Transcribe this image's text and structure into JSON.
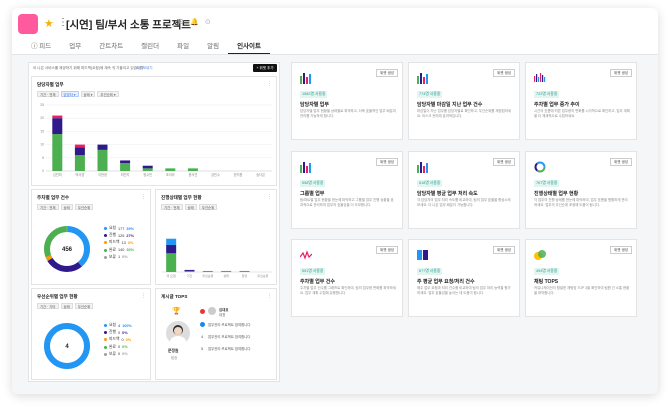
{
  "header": {
    "title": "[시연] 팀/부서 소통 프로젝트",
    "star_icon": "star-icon",
    "accent_color": "#ff5a9e"
  },
  "tabs": [
    {
      "label": "ⓘ 피드",
      "active": false
    },
    {
      "label": "업무",
      "active": false
    },
    {
      "label": "간트차트",
      "active": false
    },
    {
      "label": "캘린더",
      "active": false
    },
    {
      "label": "파일",
      "active": false
    },
    {
      "label": "알림",
      "active": false
    },
    {
      "label": "인사이트",
      "active": true
    }
  ],
  "left_panel": {
    "hint": "이 나은 서비스를 제공하기 위해 피드백(요청)에 계속 귀 기울이고 있습니다",
    "link": "의견보내기",
    "add_button": "+ 위젯 추가",
    "chips_all": [
      "기간 · 전체",
      "담당자",
      "상태",
      "우선순위"
    ]
  },
  "assignee_chart": {
    "title": "담당자별 업무",
    "chips": [
      "기간 · 전체",
      "담당자 ▾",
      "상태 ▾",
      "우선순위 ▾"
    ],
    "chart_data": {
      "type": "bar",
      "categories": [
        "김민희",
        "박서영",
        "이현정",
        "최민지",
        "정수빈",
        "조아라",
        "윤서연",
        "강민수",
        "한지원",
        "송다은"
      ],
      "series": [
        {
          "name": "완료",
          "color": "#4caf50",
          "values": [
            14,
            6,
            8,
            3,
            1,
            1,
            1,
            0,
            0,
            0
          ]
        },
        {
          "name": "진행",
          "color": "#2e1a8a",
          "values": [
            6,
            3,
            2,
            1,
            1,
            0,
            0,
            0,
            0,
            0
          ]
        },
        {
          "name": "요청",
          "color": "#e91e63",
          "values": [
            1,
            1,
            0,
            0,
            0,
            0,
            0,
            0,
            0,
            0
          ]
        }
      ],
      "yticks": [
        0,
        5,
        10,
        15,
        20,
        25
      ],
      "ylim": [
        0,
        25
      ]
    }
  },
  "status_card": {
    "title": "주차별 업무 건수",
    "chips": [
      "기간 · 전체",
      "상태",
      "우선순위"
    ],
    "total": "456",
    "legend": [
      {
        "label": "요청",
        "count": "177",
        "pct": "39%",
        "color": "#2196f3"
      },
      {
        "label": "진행",
        "count": "125",
        "count_pct": "",
        "pct": "27%",
        "color": "#2e1a8a"
      },
      {
        "label": "피드백",
        "count": "13",
        "pct": "3%",
        "color": "#ff9800"
      },
      {
        "label": "완료",
        "count": "140",
        "pct": "30%",
        "color": "#4caf50"
      },
      {
        "label": "보류",
        "count": "1",
        "pct": "0%",
        "color": "#9e9e9e"
      }
    ]
  },
  "progress_card": {
    "title": "진행상태별 업무 현황",
    "chips": [
      "기간 · 전체",
      "상태",
      "우선순위"
    ],
    "chart_data": {
      "type": "bar",
      "categories": [
        "미 요청",
        "기간",
        "우선순위",
        "상태",
        "담당",
        "우선순위"
      ],
      "series": [
        {
          "name": "완료",
          "color": "#4caf50",
          "values": [
            18,
            1,
            1,
            1,
            1,
            0
          ]
        },
        {
          "name": "진행",
          "color": "#2e1a8a",
          "values": [
            8,
            1,
            0,
            0,
            0,
            0
          ]
        },
        {
          "name": "요청",
          "color": "#2196f3",
          "values": [
            6,
            0,
            0,
            0,
            0,
            0
          ]
        }
      ],
      "ylim": [
        0,
        50
      ]
    }
  },
  "priority_card": {
    "title": "우선순위별 업무 현황",
    "chips": [
      "기간 · 기타",
      "상태",
      "우선순위"
    ],
    "total": "4",
    "legend": [
      {
        "label": "요청",
        "count": "4",
        "pct": "100%",
        "color": "#2196f3"
      },
      {
        "label": "진행",
        "count": "0",
        "pct": "0%",
        "color": "#2e1a8a"
      },
      {
        "label": "피드백",
        "count": "0",
        "pct": "0%",
        "color": "#ff9800"
      },
      {
        "label": "완료",
        "count": "0",
        "pct": "0%",
        "color": "#4caf50"
      },
      {
        "label": "보류",
        "count": "0",
        "pct": "0%",
        "color": "#9e9e9e"
      }
    ]
  },
  "tops_card": {
    "title": "게시글 TOPS",
    "user_name": "문정원",
    "user_role": "팀장",
    "items": [
      {
        "name": "김대표",
        "sub": "대표"
      },
      {
        "name": "업무관리 프로젝트 참여합니다",
        "sub": ""
      },
      {
        "name": "업무관리 프로젝트 참여합니다",
        "sub": ""
      },
      {
        "name": "업무관리 프로젝트 참여합니다",
        "sub": ""
      }
    ]
  },
  "gallery": [
    {
      "badge": "1582명 사용중",
      "name": "담당자별 업무",
      "desc": "담당자별 업무 현황을 상태별로 파악하고, 더욱 효율적인 업무 배분과 관리를 가능하게 합니다.",
      "icon": "bar-chart-icon",
      "button": "위젯 생성"
    },
    {
      "badge": "774명 사용중",
      "name": "담당자별 마감일 지난 업무 건수",
      "desc": "마감일이 지난 업무를 담당자별로 확인하고, 우선순위를 재정립하세요. 리스크 관리에 효과적입니다.",
      "icon": "bar-chart-icon",
      "button": "위젯 생성"
    },
    {
      "badge": "722명 사용중",
      "name": "주차별 업무 증가 추이",
      "desc": "시간의 흐름에 따른 업무량의 변화를 시각적으로 확인하고, 업무 계획을 더 체계적으로 수립하세요.",
      "icon": "wave-chart-icon",
      "button": "위젯 생성"
    },
    {
      "badge": "558명 사용중",
      "name": "그룹별 업무",
      "desc": "팀/파트별 업무 현황을 한눈에 파악하고 그룹별 업무 진행 상황을 효과적으로 관리하여 업무의 효율성을 더 도모합니다.",
      "icon": "bar-chart-icon",
      "button": "위젯 생성"
    },
    {
      "badge": "618명 사용중",
      "name": "담당자별 평균 업무 처리 속도",
      "desc": "각 담당자의 업무 처리 속도를 비교하여, 팀의 업무 효율을 향상시켜보세요. 더 나은 업무 배분이 가능합니다.",
      "icon": "bar-chart-icon",
      "button": "위젯 생성"
    },
    {
      "badge": "767명 사용중",
      "name": "진행상태별 업무 현황",
      "desc": "각 업무의 진행 상태를 한눈에 파악하여, 업무 흐름을 원활하게 관리하세요. 업무의 우선순위 조정에 도움이 됩니다.",
      "icon": "donut-chart-icon",
      "button": "위젯 생성"
    },
    {
      "badge": "551명 사용중",
      "name": "주차별 업무 건수",
      "desc": "주차별 업무 건수를 그래프로 확인하여, 팀의 업무량 변화를 파악하세요. 업무 계획 수립에 유용합니다.",
      "icon": "line-chart-icon",
      "button": "위젯 생성"
    },
    {
      "badge": "6??명 사용중",
      "name": "주 평균 업무 요청/처리 건수",
      "desc": "매주 업무 요청과 처리 건수를 비교하여 팀의 업무 처리 능력을 평가하세요. 업무 효율성을 높이는 데 도움이 됩니다.",
      "icon": "compare-icon",
      "button": "위젯 생성"
    },
    {
      "badge": "494명 사용중",
      "name": "채팅 TOPS",
      "desc": "커뮤니케이션이 활발한 채팅방 TOP 3을 확인하여 팀원 간 소통 현황을 파악합니다.",
      "icon": "chat-icon",
      "button": "위젯 생성"
    }
  ]
}
